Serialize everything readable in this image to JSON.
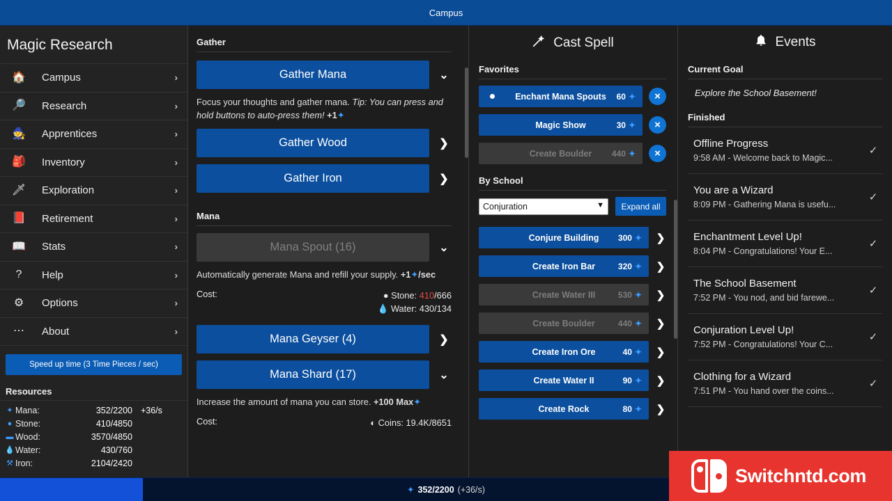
{
  "titlebar": {
    "title": "Campus"
  },
  "sidebar": {
    "title": "Magic Research",
    "items": [
      {
        "label": "Campus",
        "icon": "house-icon",
        "glyph": "🏠",
        "chevron": "›"
      },
      {
        "label": "Research",
        "icon": "magnifier-icon",
        "glyph": "🔎",
        "chevron": "›"
      },
      {
        "label": "Apprentices",
        "icon": "wizard-hat-icon",
        "glyph": "🧙",
        "chevron": "›"
      },
      {
        "label": "Inventory",
        "icon": "backpack-icon",
        "glyph": "🎒",
        "chevron": "›"
      },
      {
        "label": "Exploration",
        "icon": "sword-icon",
        "glyph": "🗡",
        "chevron": "›"
      },
      {
        "label": "Retirement",
        "icon": "book-red-icon",
        "glyph": "📕",
        "chevron": "›"
      },
      {
        "label": "Stats",
        "icon": "open-book-icon",
        "glyph": "📖",
        "chevron": "›"
      },
      {
        "label": "Help",
        "icon": "question-icon",
        "glyph": "?",
        "chevron": "›"
      },
      {
        "label": "Options",
        "icon": "gear-icon",
        "glyph": "⚙",
        "chevron": "›"
      },
      {
        "label": "About",
        "icon": "ellipsis-icon",
        "glyph": "⋯",
        "chevron": "›"
      }
    ],
    "speed_button": "Speed up time (3 Time Pieces / sec)",
    "resources_header": "Resources",
    "resources": [
      {
        "icon": "mana-star-icon",
        "glyph": "✦",
        "name": "Mana:",
        "value": "352/2200",
        "rate": "+36/s"
      },
      {
        "icon": "stone-icon",
        "glyph": "●",
        "name": "Stone:",
        "value": "410/4850",
        "rate": ""
      },
      {
        "icon": "wood-icon",
        "glyph": "▬",
        "name": "Wood:",
        "value": "3570/4850",
        "rate": ""
      },
      {
        "icon": "water-drop-icon",
        "glyph": "💧",
        "name": "Water:",
        "value": "430/760",
        "rate": ""
      },
      {
        "icon": "iron-icon",
        "glyph": "⚒",
        "name": "Iron:",
        "value": "2104/2420",
        "rate": ""
      }
    ]
  },
  "gather": {
    "section_gather": "Gather",
    "section_mana": "Mana",
    "buttons": [
      {
        "label": "Gather Mana",
        "disabled": false,
        "expander": "❯",
        "expanded": true,
        "desc_plain": "Focus your thoughts and gather mana. ",
        "desc_italic": "Tip: You can press and hold buttons to auto-press them!",
        "desc_gain": "+1",
        "desc_gain_icon": "✦"
      },
      {
        "label": "Gather Wood",
        "disabled": false,
        "expander": "❯",
        "expanded": false
      },
      {
        "label": "Gather Iron",
        "disabled": false,
        "expander": "❯",
        "expanded": false
      }
    ],
    "mana_buttons": [
      {
        "label": "Mana Spout (16)",
        "disabled": true,
        "expander": "❯",
        "expanded": true,
        "desc_plain": "Automatically generate Mana and refill your supply. ",
        "desc_gain": "+1",
        "desc_gain_icon": "✦",
        "desc_suffix": "/sec",
        "cost_label": "Cost:",
        "costs": [
          {
            "icon": "stone-icon",
            "glyph": "●",
            "name": "Stone:",
            "have": "410",
            "need": "/666",
            "short": true
          },
          {
            "icon": "water-drop-icon",
            "glyph": "💧",
            "name": "Water:",
            "have": "430",
            "need": "/134",
            "short": false
          }
        ]
      },
      {
        "label": "Mana Geyser (4)",
        "disabled": false,
        "expander": "❯",
        "expanded": false
      },
      {
        "label": "Mana Shard (17)",
        "disabled": false,
        "expander": "❯",
        "expanded": true,
        "desc_plain": "Increase the amount of mana you can store. ",
        "desc_gain": "+100 Max",
        "desc_gain_icon": "✦",
        "cost_label": "Cost:",
        "costs": [
          {
            "icon": "coins-icon",
            "glyph": "◐",
            "name": "Coins:",
            "have": "19.4K",
            "need": "/8651",
            "short": false
          }
        ]
      }
    ]
  },
  "cast_spell": {
    "title": "Cast Spell",
    "title_icon": "wand-icon",
    "favorites_header": "Favorites",
    "favorites": [
      {
        "name": "Enchant Mana Spouts",
        "cost": "60",
        "cost_icon": "✦",
        "disabled": false,
        "active": true,
        "remove": "×"
      },
      {
        "name": "Magic Show",
        "cost": "30",
        "cost_icon": "✦",
        "disabled": false,
        "active": false,
        "remove": "×"
      },
      {
        "name": "Create Boulder",
        "cost": "440",
        "cost_icon": "✦",
        "disabled": true,
        "active": false,
        "remove": "×"
      }
    ],
    "by_school_header": "By School",
    "school_selected": "Conjuration",
    "school_options": [
      "Conjuration"
    ],
    "expand_all_label": "Expand all",
    "spells": [
      {
        "name": "Conjure Building",
        "cost": "300",
        "cost_icon": "✦",
        "disabled": false,
        "chevron": "❯"
      },
      {
        "name": "Create Iron Bar",
        "cost": "320",
        "cost_icon": "✦",
        "disabled": false,
        "chevron": "❯"
      },
      {
        "name": "Create Water III",
        "cost": "530",
        "cost_icon": "✦",
        "disabled": true,
        "chevron": "❯"
      },
      {
        "name": "Create Boulder",
        "cost": "440",
        "cost_icon": "✦",
        "disabled": true,
        "chevron": "❯"
      },
      {
        "name": "Create Iron Ore",
        "cost": "40",
        "cost_icon": "✦",
        "disabled": false,
        "chevron": "❯"
      },
      {
        "name": "Create Water II",
        "cost": "90",
        "cost_icon": "✦",
        "disabled": false,
        "chevron": "❯"
      },
      {
        "name": "Create Rock",
        "cost": "80",
        "cost_icon": "✦",
        "disabled": false,
        "chevron": "❯"
      }
    ]
  },
  "events": {
    "title": "Events",
    "title_icon": "bell-icon",
    "current_goal_header": "Current Goal",
    "current_goal": "Explore the School Basement!",
    "finished_header": "Finished",
    "finished": [
      {
        "title": "Offline Progress",
        "sub": "9:58 AM - Welcome back to Magic...",
        "check": "✓"
      },
      {
        "title": "You are a Wizard",
        "sub": "8:09 PM - Gathering Mana is usefu...",
        "check": "✓"
      },
      {
        "title": "Enchantment Level Up!",
        "sub": "8:04 PM - Congratulations! Your E...",
        "check": "✓"
      },
      {
        "title": "The School Basement",
        "sub": "7:52 PM - You nod, and bid farewe...",
        "check": "✓"
      },
      {
        "title": "Conjuration Level Up!",
        "sub": "7:52 PM - Congratulations! Your C...",
        "check": "✓"
      },
      {
        "title": "Clothing for a Wizard",
        "sub": "7:51 PM - You hand over the coins...",
        "check": "✓"
      }
    ]
  },
  "bottom_bar": {
    "icon": "mana-star-icon",
    "glyph": "✦",
    "amount": "352/2200",
    "rate": "(+36/s)",
    "fill_percent": 16
  },
  "watermark": {
    "text": "Switchntd.com",
    "color": "#e8342e"
  },
  "colors": {
    "accent_blue": "#0b4f9e",
    "bright_blue": "#1074d4",
    "title_blue": "#0b4c97",
    "disabled_gray": "#3a3a3a",
    "bg_dark": "#1d1d1d",
    "sidebar_bg": "#232323",
    "mana_star": "#3d9bff",
    "low_red": "#e04a4a"
  }
}
